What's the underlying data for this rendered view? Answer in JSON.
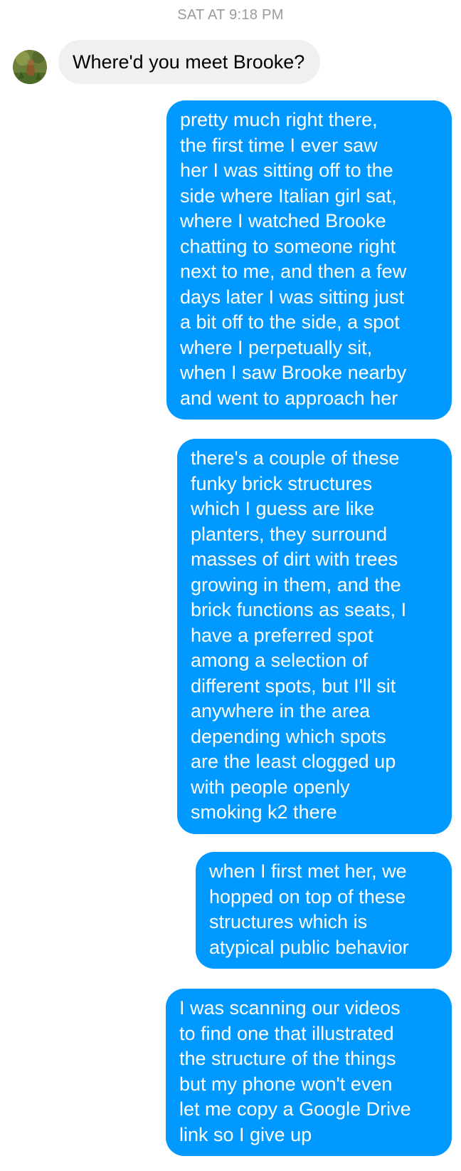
{
  "conversation": {
    "timestamp": "SAT AT 9:18 PM",
    "incoming": {
      "text": "Where'd you meet Brooke?"
    },
    "outgoing": [
      {
        "text": "pretty much right there,\nthe first time I ever saw\nher I was sitting off to the\nside where Italian girl sat,\nwhere I watched Brooke\nchatting to someone right\nnext to me, and then a few\ndays later I was sitting just\na bit off to the side, a spot\nwhere I perpetually sit,\nwhen I saw Brooke nearby\nand went to approach her"
      },
      {
        "text": "there's a couple of these\nfunky brick structures\nwhich I guess are like\nplanters, they surround\nmasses of dirt with trees\ngrowing in them, and the\nbrick functions as seats, I\nhave a preferred spot\namong a selection of\ndifferent spots, but I'll sit\nanywhere in the area\ndepending which spots\nare the least clogged up\nwith people openly\nsmoking k2 there"
      },
      {
        "text": "when I first met her, we\nhopped on top of these\nstructures which is\natypical public behavior"
      },
      {
        "text": "I was scanning our videos\nto find one that illustrated\nthe structure of the things\nbut my phone won't even\nlet me copy a Google Drive\nlink so I give up"
      }
    ]
  },
  "colors": {
    "outgoing_bubble": "#0099ff",
    "incoming_bubble": "#f1f0f0",
    "timestamp_text": "#9b9b9b"
  },
  "icons": {
    "avatar": "contact-avatar-photo"
  }
}
